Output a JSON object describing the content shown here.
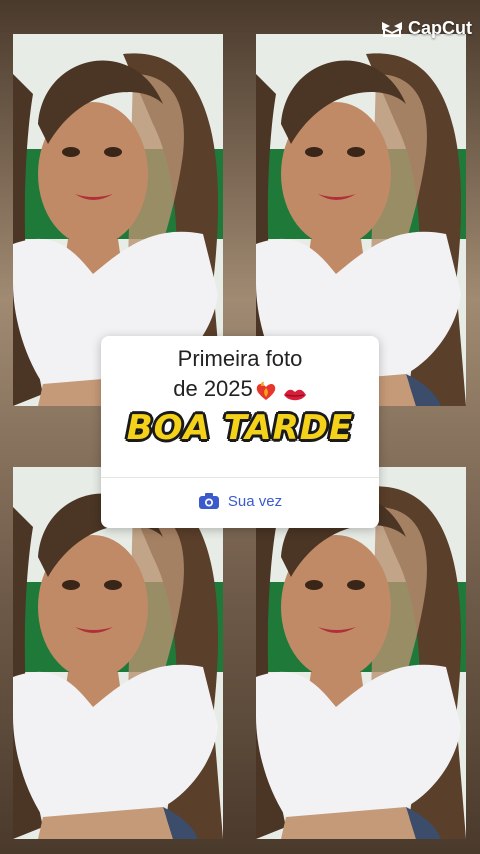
{
  "watermark": {
    "brand": "CapCut",
    "icon": "capcut-logo-icon"
  },
  "card": {
    "caption_line1": "Primeira foto",
    "caption_line2": "de 2025",
    "emojis": [
      "heart-on-fire-icon",
      "kiss-lips-icon"
    ],
    "sticker_text": "BOA TARDE",
    "reply_label": "Sua vez",
    "reply_icon": "camera-icon"
  },
  "colors": {
    "sticker_fill": "#f5d21a",
    "reply_accent": "#3b5bcc",
    "card_bg": "#ffffff"
  }
}
